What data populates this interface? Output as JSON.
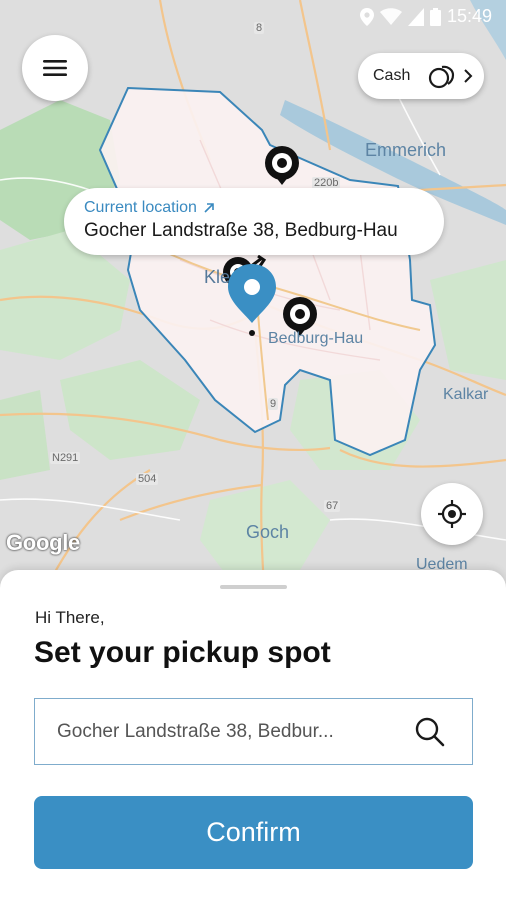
{
  "status_bar": {
    "time": "15:49",
    "icons": [
      "location-icon",
      "wifi-icon",
      "signal-icon",
      "battery-icon"
    ]
  },
  "map": {
    "labels": {
      "emmerich": "Emmerich",
      "kleve": "Kle",
      "bedburg": "Bedburg-Hau",
      "kalkar": "Kalkar",
      "goch": "Goch",
      "uedem": "Uedem"
    },
    "roads": {
      "r8": "8",
      "r220": "220b",
      "r9": "9",
      "n291": "N291",
      "r504": "504",
      "r67": "67"
    },
    "attribution": "Google"
  },
  "menu": {
    "icon": "hamburger-menu-icon"
  },
  "payment": {
    "label": "Cash",
    "icon": "coins-icon",
    "chevron": "chevron-right-icon"
  },
  "location_bubble": {
    "caption": "Current location",
    "caption_icon": "arrow-up-right-icon",
    "address": "Gocher Landstraße 38, Bedburg-Hau"
  },
  "locate_button": {
    "icon": "crosshair-icon"
  },
  "sheet": {
    "greeting": "Hi There,",
    "title": "Set your pickup spot",
    "search_value": "Gocher Landstraße 38, Bedbur...",
    "search_icon": "search-icon",
    "confirm_label": "Confirm"
  },
  "colors": {
    "accent": "#3a8fc4",
    "zone_border": "#3b86b8",
    "pin": "#3a8fc4"
  }
}
